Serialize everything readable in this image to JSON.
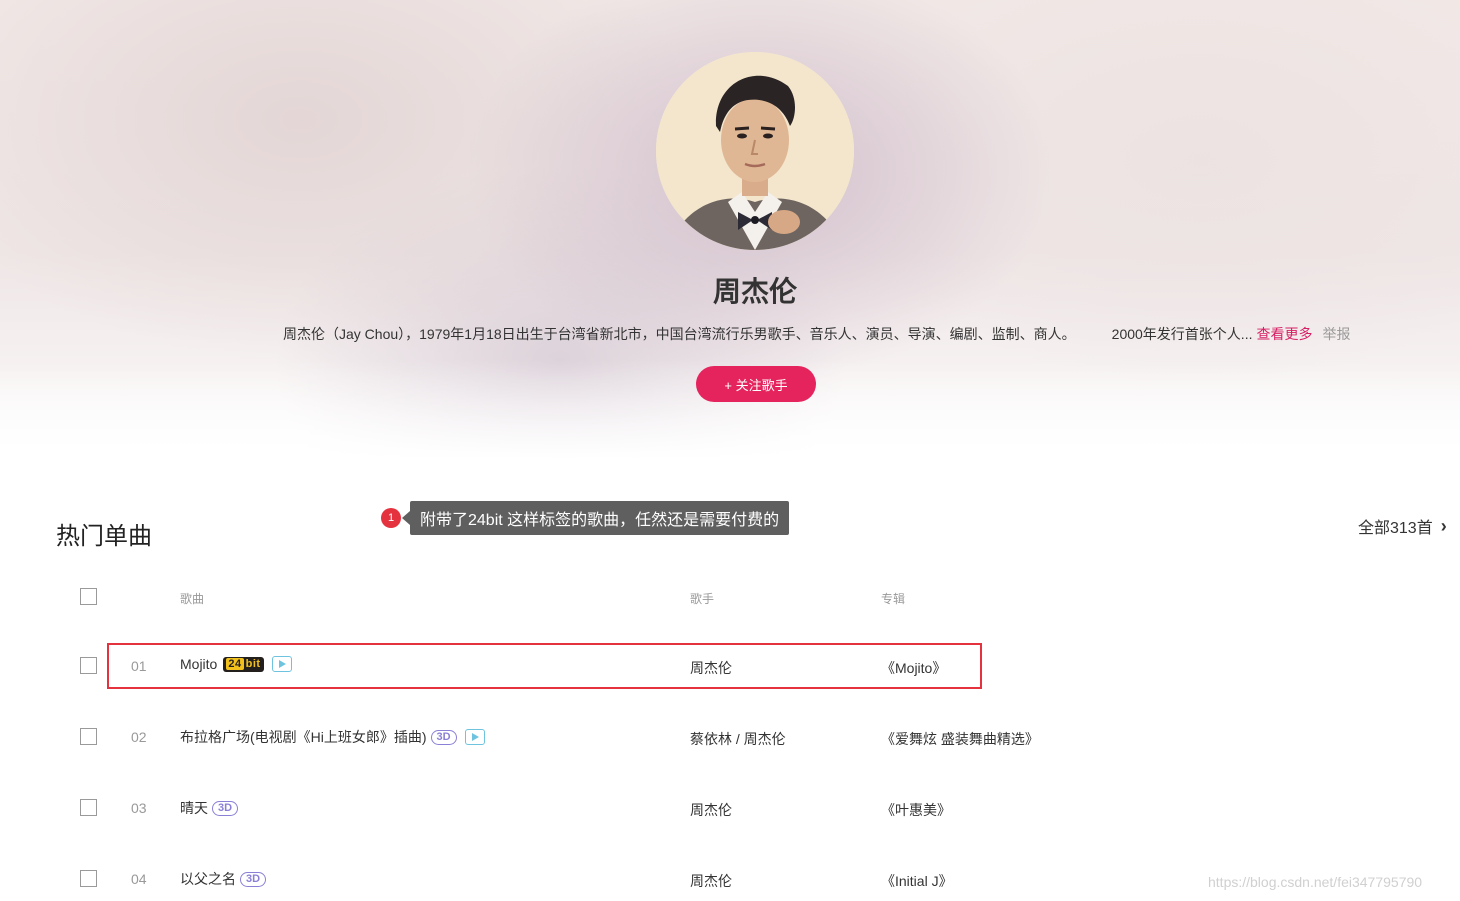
{
  "artist": {
    "name": "周杰伦",
    "intro": "周杰伦（Jay Chou），1979年1月18日出生于台湾省新北市，中国台湾流行乐男歌手、音乐人、演员、导演、编剧、监制、商人。",
    "intro_tail": "2000年发行首张个人...",
    "more_label": "查看更多",
    "report_label": "举报",
    "follow_label": "+ 关注歌手"
  },
  "section": {
    "title": "热门单曲",
    "all_label": "全部313首",
    "chevron_icon": "chevron-right-icon"
  },
  "annotation": {
    "number": "1",
    "text": "附带了24bit 这样标签的歌曲，任然还是需要付费的",
    "box_color": "#e5323f"
  },
  "table": {
    "headers": {
      "song": "歌曲",
      "artist": "歌手",
      "album": "专辑"
    },
    "rows": [
      {
        "num": "01",
        "song": "Mojito",
        "tags": [
          "24bit",
          "mv"
        ],
        "artist": "周杰伦",
        "album": "《Mojito》"
      },
      {
        "num": "02",
        "song": "布拉格广场(电视剧《Hi上班女郎》插曲)",
        "tags": [
          "3D",
          "mv"
        ],
        "artist": "蔡依林 / 周杰伦",
        "album": "《爱舞炫 盛装舞曲精选》"
      },
      {
        "num": "03",
        "song": "晴天",
        "tags": [
          "3D"
        ],
        "artist": "周杰伦",
        "album": "《叶惠美》"
      },
      {
        "num": "04",
        "song": "以父之名",
        "tags": [
          "3D"
        ],
        "artist": "周杰伦",
        "album": "《Initial J》"
      }
    ],
    "tag_labels": {
      "bit_lead": "24",
      "bit_tail": "bit",
      "threed": "3D"
    }
  },
  "watermark": "https://blog.csdn.net/fei347795790",
  "colors": {
    "accent": "#e5245d",
    "link": "#d61f64",
    "badge_3d": "#8a80d6",
    "mv": "#6ec4df"
  }
}
